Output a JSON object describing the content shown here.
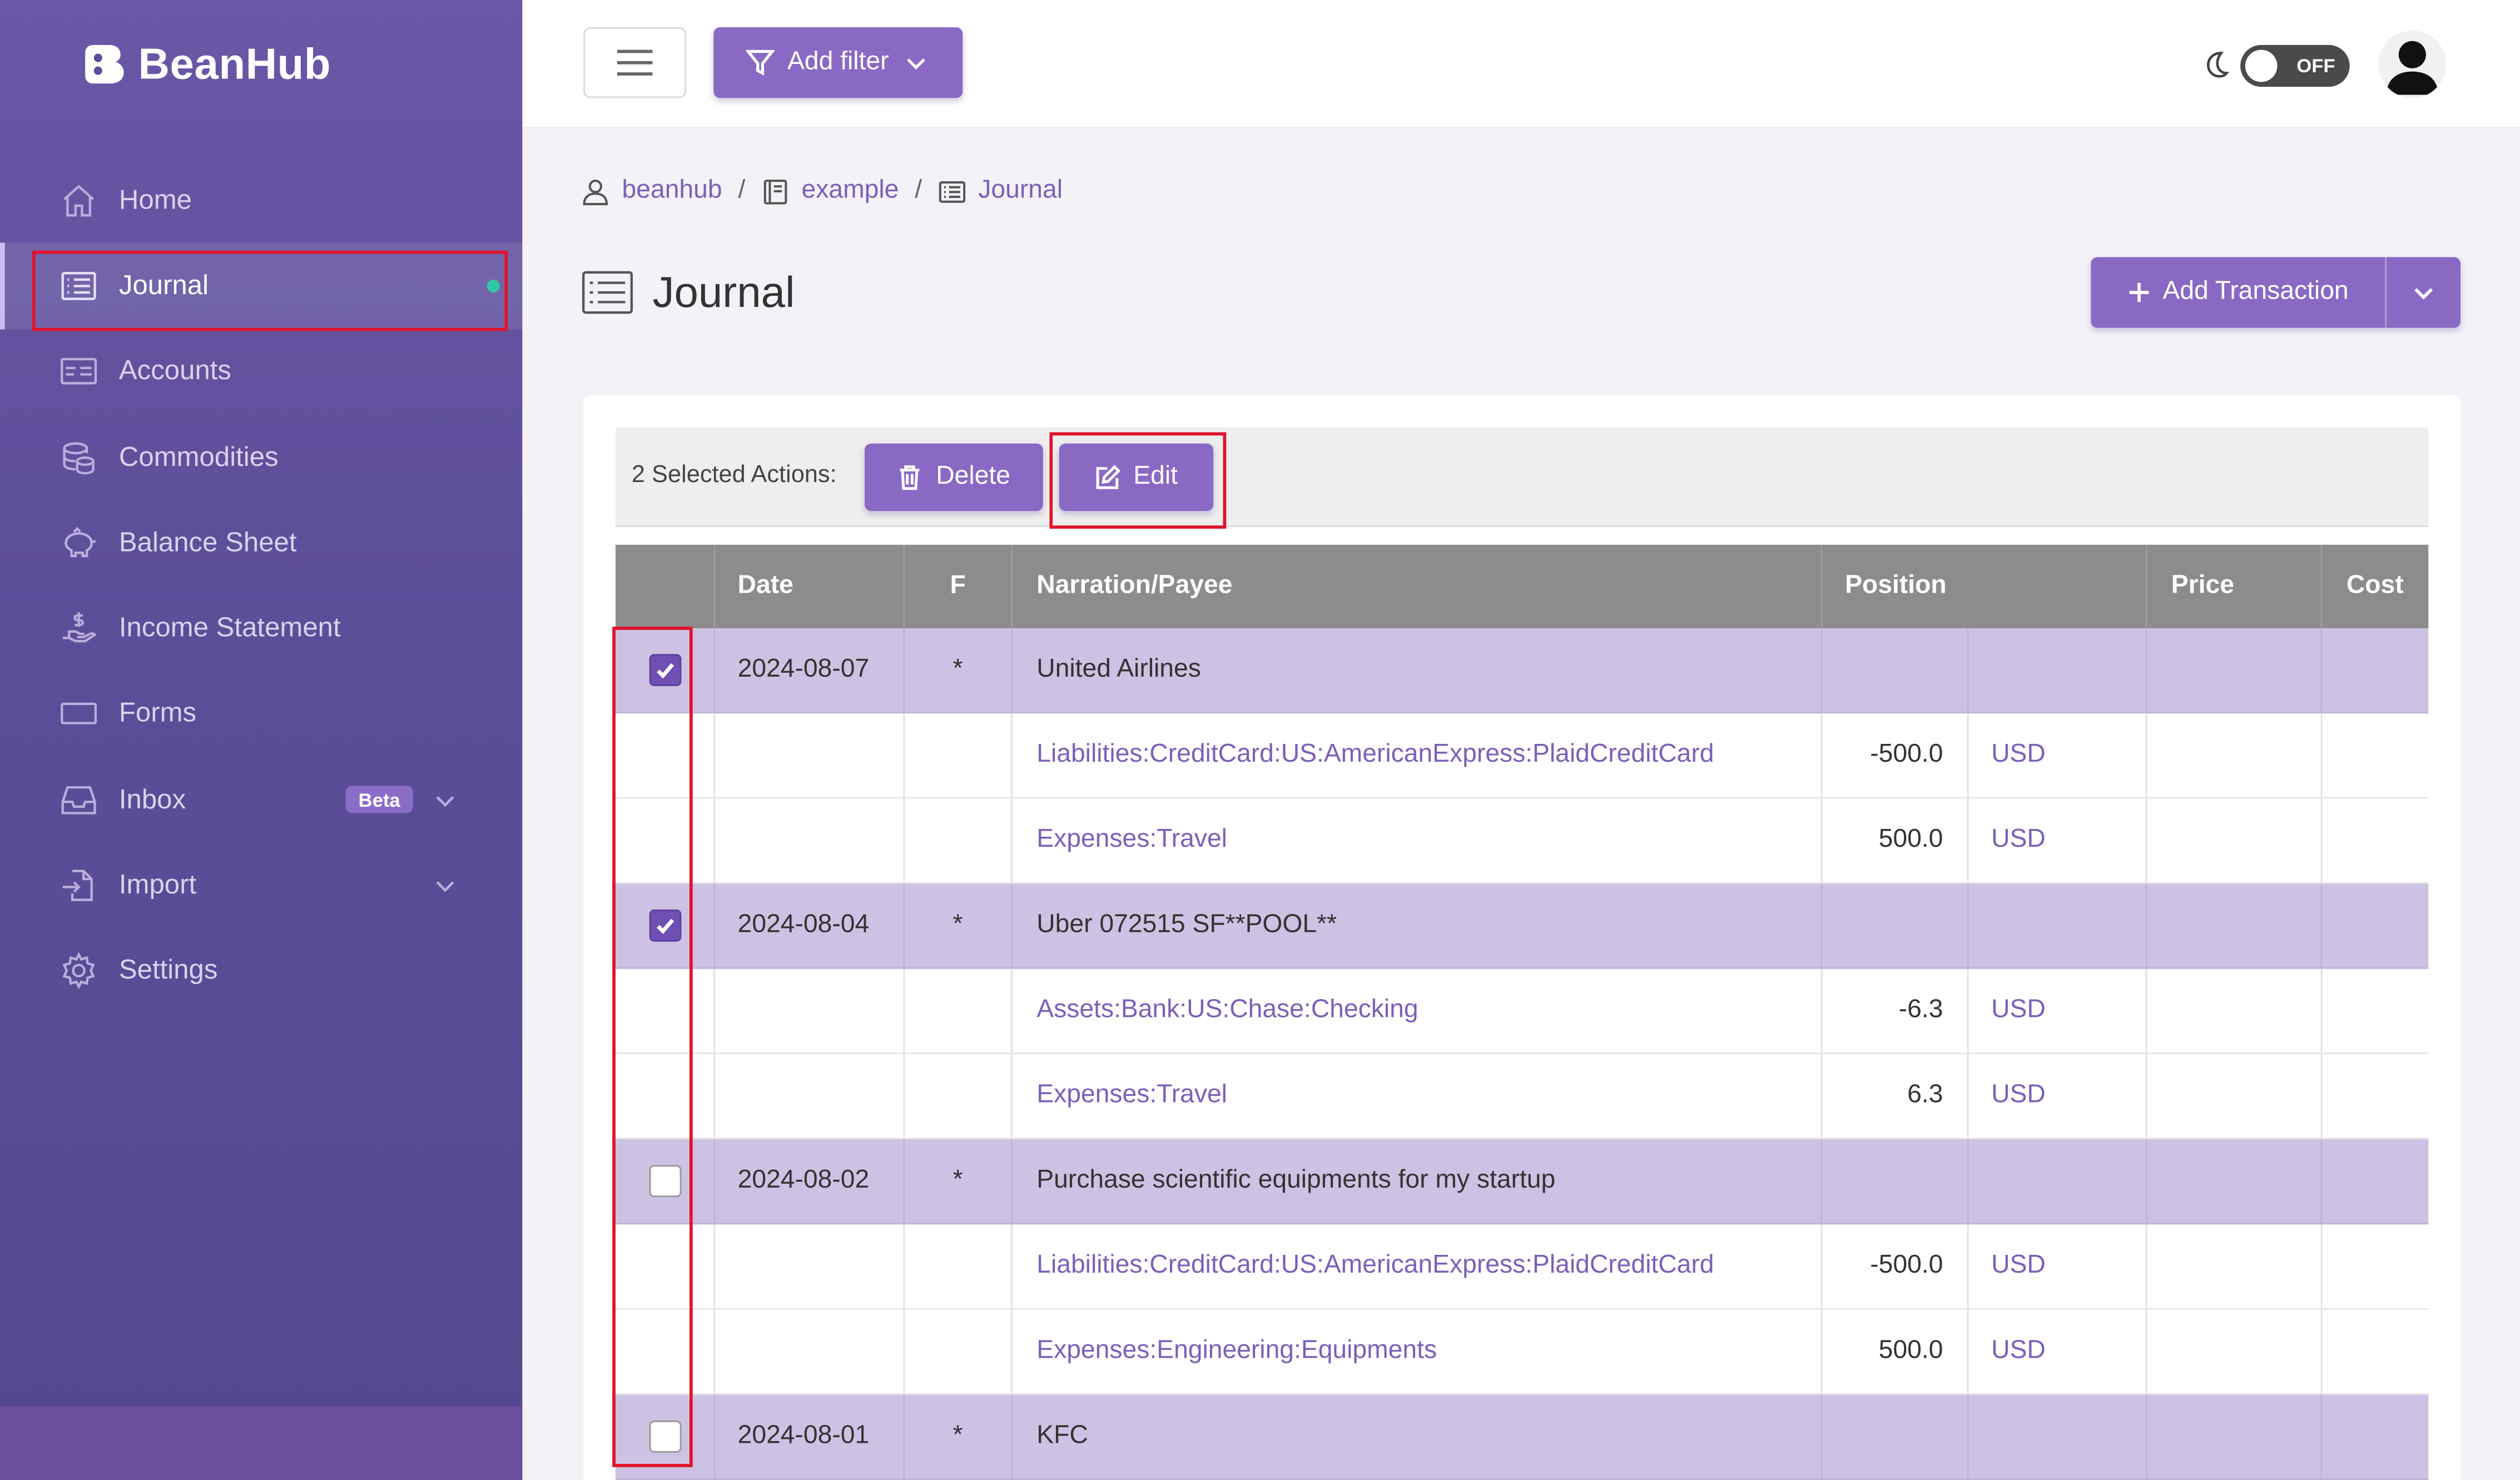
{
  "app": {
    "brand": "BeanHub"
  },
  "sidebar": {
    "items": [
      {
        "label": "Home",
        "icon": "home-icon"
      },
      {
        "label": "Journal",
        "icon": "list-icon",
        "active": true
      },
      {
        "label": "Accounts",
        "icon": "card-icon"
      },
      {
        "label": "Commodities",
        "icon": "coins-icon"
      },
      {
        "label": "Balance Sheet",
        "icon": "piggy-bank-icon"
      },
      {
        "label": "Income Statement",
        "icon": "hand-money-icon"
      },
      {
        "label": "Forms",
        "icon": "form-icon"
      },
      {
        "label": "Inbox",
        "icon": "inbox-icon",
        "badge": "Beta"
      },
      {
        "label": "Import",
        "icon": "import-icon"
      },
      {
        "label": "Settings",
        "icon": "gear-icon"
      }
    ]
  },
  "topbar": {
    "add_filter": "Add filter",
    "dark_mode_toggle": "OFF"
  },
  "breadcrumb": {
    "user": "beanhub",
    "repo": "example",
    "page": "Journal"
  },
  "page": {
    "title": "Journal",
    "add_transaction": "Add Transaction"
  },
  "actions": {
    "selected_label": "2 Selected Actions:",
    "delete": "Delete",
    "edit": "Edit"
  },
  "table": {
    "headers": {
      "date": "Date",
      "flag": "F",
      "narration": "Narration/Payee",
      "position": "Position",
      "price": "Price",
      "cost": "Cost"
    },
    "transactions": [
      {
        "checked": true,
        "date": "2024-08-07",
        "flag": "*",
        "narration": "United Airlines",
        "postings": [
          {
            "account": "Liabilities:CreditCard:US:AmericanExpress:PlaidCreditCard",
            "amount": "-500.0",
            "currency": "USD"
          },
          {
            "account": "Expenses:Travel",
            "amount": "500.0",
            "currency": "USD"
          }
        ]
      },
      {
        "checked": true,
        "date": "2024-08-04",
        "flag": "*",
        "narration": "Uber 072515 SF**POOL**",
        "postings": [
          {
            "account": "Assets:Bank:US:Chase:Checking",
            "amount": "-6.3",
            "currency": "USD"
          },
          {
            "account": "Expenses:Travel",
            "amount": "6.3",
            "currency": "USD"
          }
        ]
      },
      {
        "checked": false,
        "date": "2024-08-02",
        "flag": "*",
        "narration": "Purchase scientific equipments for my startup",
        "postings": [
          {
            "account": "Liabilities:CreditCard:US:AmericanExpress:PlaidCreditCard",
            "amount": "-500.0",
            "currency": "USD"
          },
          {
            "account": "Expenses:Engineering:Equipments",
            "amount": "500.0",
            "currency": "USD"
          }
        ]
      },
      {
        "checked": false,
        "date": "2024-08-01",
        "flag": "*",
        "narration": "KFC",
        "postings": []
      }
    ]
  },
  "colors": {
    "sidebar": "#5b4d98",
    "accent": "#8a69c4",
    "tx_row": "#cdc2e3",
    "header": "#8c8c8c",
    "highlight": "#e0142b"
  }
}
